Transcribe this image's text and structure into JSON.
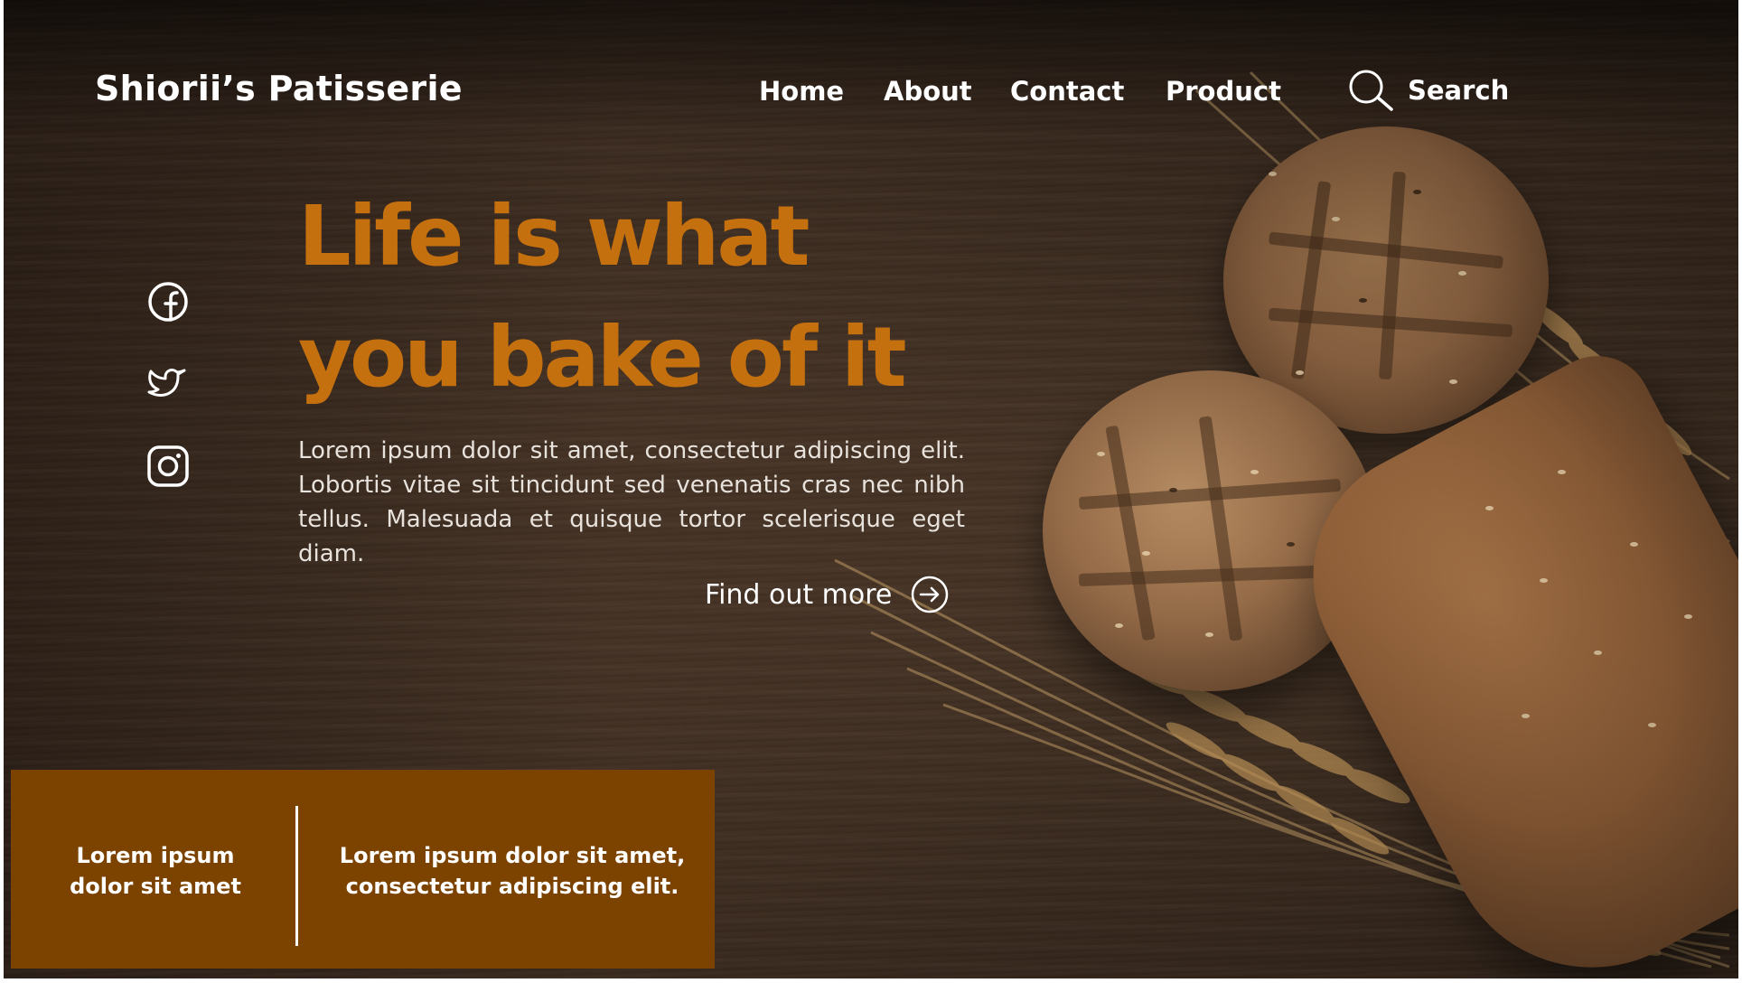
{
  "brand": {
    "name": "Shiorii’s Patisserie"
  },
  "nav": {
    "items": [
      {
        "label": "Home"
      },
      {
        "label": "About"
      },
      {
        "label": "Contact"
      },
      {
        "label": "Product"
      }
    ],
    "search_label": "Search",
    "search_icon": "search-icon"
  },
  "hero": {
    "title_line1": "Life is what",
    "title_line2": "you bake of it",
    "body": "Lorem ipsum dolor sit amet, consectetur adipiscing elit. Lobortis vitae sit tincidunt sed venenatis cras nec nibh tellus. Malesuada et quisque tortor scelerisque eget diam.",
    "cta_label": "Find out more",
    "cta_icon": "arrow-right-circle-icon"
  },
  "social": {
    "icons": [
      "facebook-icon",
      "twitter-icon",
      "instagram-icon"
    ]
  },
  "info_box": {
    "left_line1": "Lorem ipsum",
    "left_line2": "dolor sit amet",
    "right_line1": "Lorem ipsum dolor sit amet,",
    "right_line2": "consectetur adipiscing elit."
  },
  "colors": {
    "accent": "#c5700f",
    "info_box_bg": "#7c4300",
    "text_light": "#ffffff",
    "background_wood": "#3f2e22"
  }
}
